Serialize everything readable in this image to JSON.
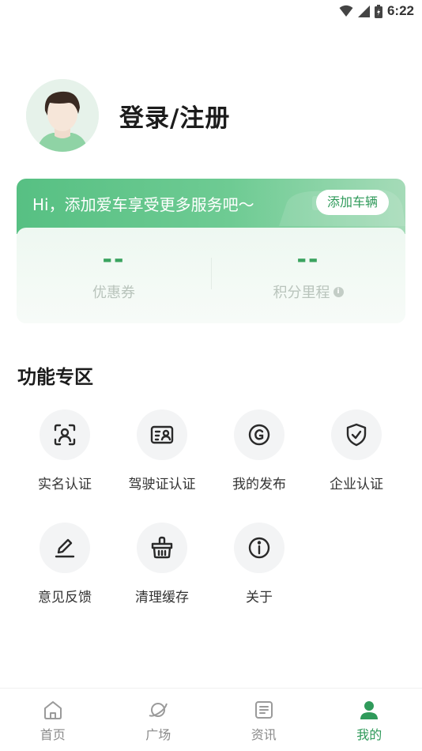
{
  "status_bar": {
    "time": "6:22"
  },
  "profile": {
    "login_label": "登录/注册"
  },
  "car_card": {
    "banner_text": "Hi，添加爱车享受更多服务吧～",
    "add_car_label": "添加车辆",
    "stats": [
      {
        "value": "--",
        "label": "优惠券"
      },
      {
        "value": "--",
        "label": "积分里程"
      }
    ],
    "info_icon": "i"
  },
  "section": {
    "title": "功能专区"
  },
  "functions": [
    {
      "label": "实名认证",
      "icon": "face-scan-icon"
    },
    {
      "label": "驾驶证认证",
      "icon": "license-card-icon"
    },
    {
      "label": "我的发布",
      "icon": "publish-icon"
    },
    {
      "label": "企业认证",
      "icon": "shield-check-icon"
    },
    {
      "label": "意见反馈",
      "icon": "edit-icon"
    },
    {
      "label": "清理缓存",
      "icon": "basket-icon"
    },
    {
      "label": "关于",
      "icon": "info-icon"
    }
  ],
  "bottom_nav": [
    {
      "label": "首页",
      "icon": "home-icon"
    },
    {
      "label": "广场",
      "icon": "planet-icon"
    },
    {
      "label": "资讯",
      "icon": "news-icon"
    },
    {
      "label": "我的",
      "icon": "person-icon",
      "active": true
    }
  ],
  "colors": {
    "accent": "#2f9a5a",
    "stat_value": "#3aa35f"
  }
}
